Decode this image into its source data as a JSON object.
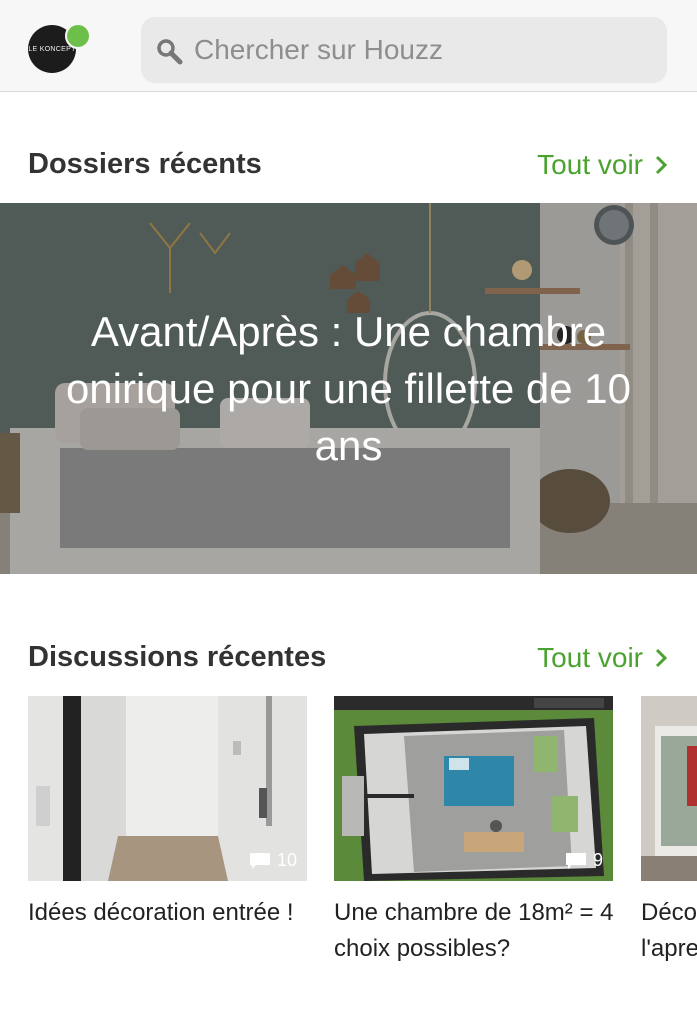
{
  "header": {
    "profile_initials": "LE KONCEPT",
    "search_placeholder": "Chercher sur Houzz"
  },
  "recent_folders": {
    "title": "Dossiers récents",
    "see_all": "Tout voir",
    "featured": {
      "title": "Avant/Après : Une chambre onirique pour une fillette de 10 ans"
    }
  },
  "recent_discussions": {
    "title": "Discussions récentes",
    "see_all": "Tout voir",
    "items": [
      {
        "title": "Idées décoration entrée !",
        "comments": "10"
      },
      {
        "title": "Une chambre de 18m² = 4 choix possibles?",
        "comments": "9"
      },
      {
        "title": "Déco l'apre",
        "comments": ""
      }
    ]
  },
  "colors": {
    "accent": "#4ba32f",
    "presence_dot": "#6cc04a"
  }
}
